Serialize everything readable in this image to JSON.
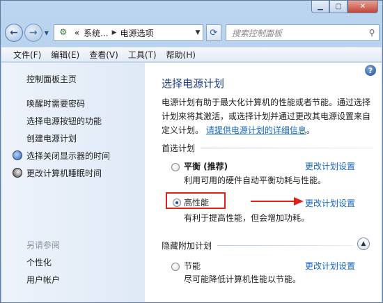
{
  "address_bar": {
    "prefix": "«",
    "segments": [
      "系统...",
      "电源选项"
    ]
  },
  "search": {
    "placeholder": "搜索控制面板"
  },
  "menu": [
    "文件(F)",
    "编辑(E)",
    "查看(V)",
    "工具(T)",
    "帮助(H)"
  ],
  "sidebar": {
    "home": "控制面板主页",
    "links": [
      "唤醒时需要密码",
      "选择电源按钮的功能",
      "创建电源计划",
      "选择关闭显示器的时间",
      "更改计算机睡眠时间"
    ],
    "see_also_title": "另请参阅",
    "see_also": [
      "个性化",
      "用户帐户"
    ]
  },
  "main": {
    "title": "选择电源计划",
    "description": "电源计划有助于最大化计算机的性能或者节能。通过选择计划来将其激活，或选择计划并通过更改其电源设置来自定义计划。",
    "more_info_link": "请提供电源计划的详细信息",
    "description_end": "。",
    "preferred_section": "首选计划",
    "hidden_section": "隐藏附加计划",
    "plans": [
      {
        "name": "平衡 (推荐)",
        "desc": "利用可用的硬件自动平衡功耗与性能。",
        "link": "更改计划设置",
        "selected": false
      },
      {
        "name": "高性能",
        "desc": "有利于提高性能，但会增加功耗。",
        "link": "更改计划设置",
        "selected": true
      },
      {
        "name": "节能",
        "desc": "尽可能降低计算机性能以节能。",
        "link": "更改计划设置",
        "selected": false
      }
    ]
  },
  "colors": {
    "link": "#1466c1",
    "title": "#1f3f8a",
    "highlight": "#e0201a"
  },
  "icons": [
    "minimize-icon",
    "maximize-icon",
    "close-icon",
    "back-icon",
    "forward-icon",
    "refresh-icon",
    "search-icon",
    "help-icon",
    "display-icon",
    "sleep-icon",
    "collapse-icon"
  ]
}
